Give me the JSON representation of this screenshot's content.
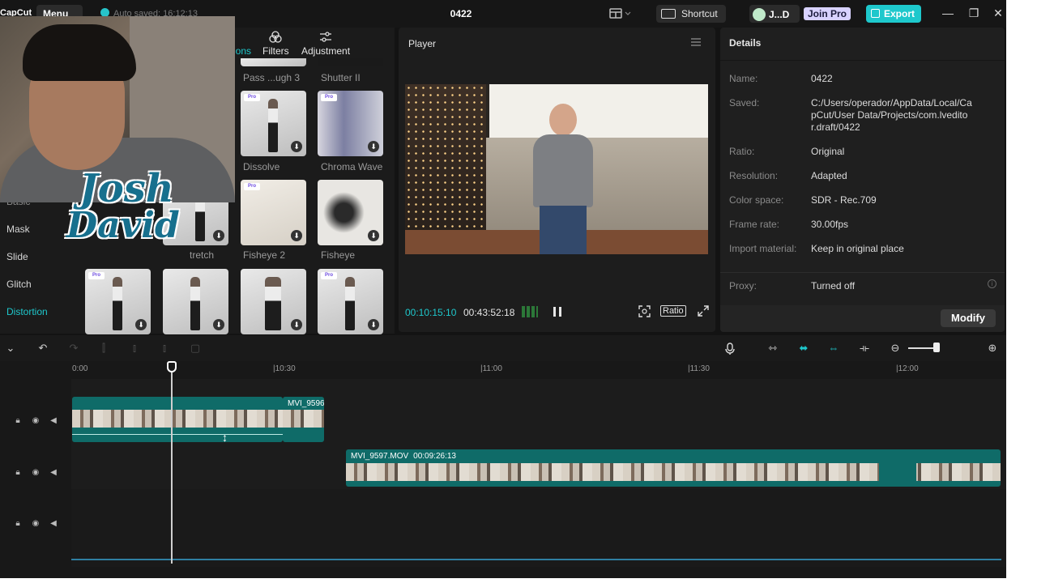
{
  "titlebar": {
    "logo": "CapCut",
    "menu_label": "Menu",
    "autosave": "Auto saved: 16:12:13",
    "project_title": "0422",
    "shortcut_label": "Shortcut",
    "user_label": "J...D",
    "join_pro_label": "Join Pro",
    "export_label": "Export"
  },
  "media_panel": {
    "tabs": [
      {
        "label": "ions",
        "icon": "transitions-icon"
      },
      {
        "label": "Filters",
        "icon": "filters-icon"
      },
      {
        "label": "Adjustment",
        "icon": "adjustment-icon"
      }
    ],
    "side_nav": [
      {
        "label": "Basic"
      },
      {
        "label": "Mask"
      },
      {
        "label": "Slide"
      },
      {
        "label": "Glitch"
      },
      {
        "label": "Distortion",
        "active": true
      }
    ],
    "tile_labels": [
      "Pass ...ugh 3",
      "Shutter II",
      "Dissolve",
      "Chroma Wave",
      "tretch",
      "Fisheye 2",
      "Fisheye"
    ],
    "pro_badge": "Pro"
  },
  "overlay": {
    "logo_line1": "Josh",
    "logo_line2": "David"
  },
  "player": {
    "title": "Player",
    "current_time": "00:10:15:10",
    "total_time": "00:43:52:18",
    "ratio_label": "Ratio"
  },
  "details": {
    "title": "Details",
    "rows": [
      {
        "label": "Name:",
        "value": "0422"
      },
      {
        "label": "Saved:",
        "value": "C:/Users/operador/AppData/Local/CapCut/User Data/Projects/com.lveditor.draft/0422"
      },
      {
        "label": "Ratio:",
        "value": "Original"
      },
      {
        "label": "Resolution:",
        "value": "Adapted"
      },
      {
        "label": "Color space:",
        "value": "SDR - Rec.709"
      },
      {
        "label": "Frame rate:",
        "value": "30.00fps"
      },
      {
        "label": "Import material:",
        "value": "Keep in original place"
      },
      {
        "label": "Proxy:",
        "value": "Turned off"
      }
    ],
    "modify_label": "Modify"
  },
  "timeline": {
    "ruler_labels": [
      "0:00",
      "10:30",
      "11:00",
      "11:30",
      "12:00"
    ],
    "clips": [
      {
        "name": "MVI_9596",
        "duration": ""
      },
      {
        "name": "MVI_9597.MOV",
        "duration": "00:09:26:13"
      }
    ],
    "zoom_level": 0.85
  },
  "colors": {
    "accent": "#1ec8cc",
    "clip": "#0f6b68",
    "background": "#131313"
  }
}
